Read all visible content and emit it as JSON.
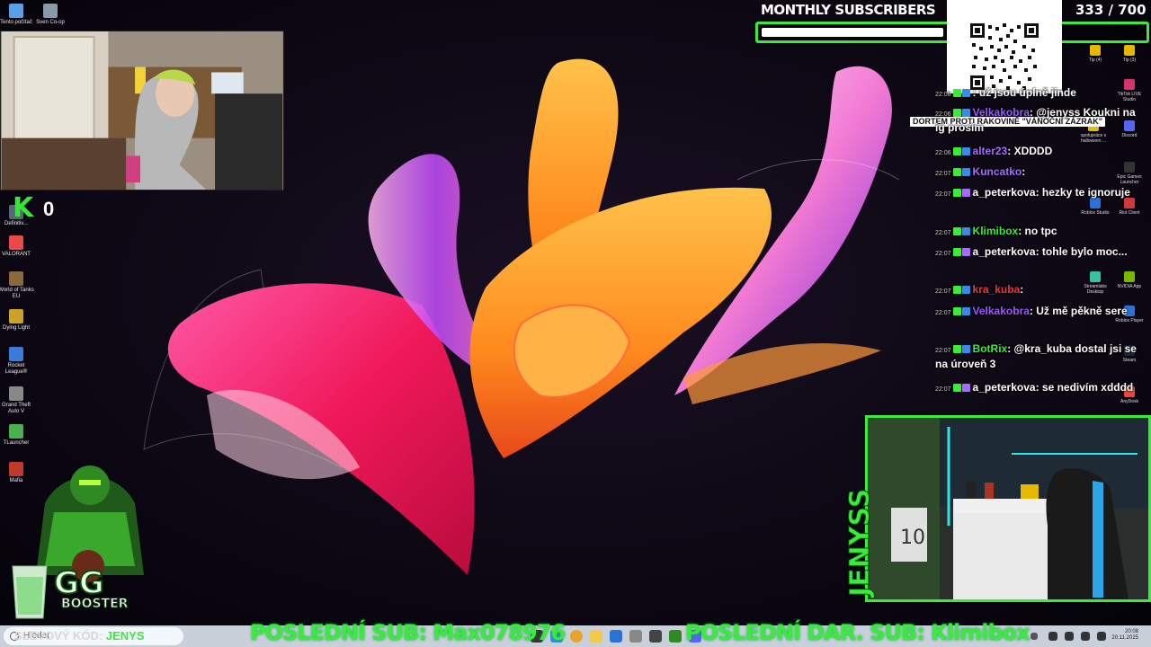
{
  "desktop_icons_left": [
    {
      "label": "Tento počítač",
      "icon": "computer-icon",
      "color": "#5aa0e6"
    },
    {
      "label": "Sven Co-op",
      "icon": "game-icon",
      "color": "#8899aa"
    },
    {
      "label": "Definitiv...",
      "icon": "game-icon",
      "color": "#556677"
    },
    {
      "label": "VALORANT",
      "icon": "valorant-icon",
      "color": "#e84a4a"
    },
    {
      "label": "World of Tanks EU",
      "icon": "tank-icon",
      "color": "#8a6a3a"
    },
    {
      "label": "Dying Light",
      "icon": "game-icon",
      "color": "#c9a227"
    },
    {
      "label": "Rocket League®",
      "icon": "rocket-icon",
      "color": "#3a7ad8"
    },
    {
      "label": "Grand Theft Auto V",
      "icon": "gta-icon",
      "color": "#888888"
    },
    {
      "label": "TLauncher",
      "icon": "minecraft-icon",
      "color": "#4caf50"
    },
    {
      "label": "Mafia",
      "icon": "mafia-icon",
      "color": "#c0392b"
    }
  ],
  "desktop_icons_right": [
    {
      "label": "Tip (4)",
      "icon": "tip-icon",
      "color": "#e6b800"
    },
    {
      "label": "Tip (3)",
      "icon": "tip-icon",
      "color": "#e6b800"
    },
    {
      "label": "TikTok LIVE Studio",
      "icon": "tiktok-icon",
      "color": "#d6336c"
    },
    {
      "label": "spolupráce s halloween ...",
      "icon": "folder-icon",
      "color": "#e6b800"
    },
    {
      "label": "Discord",
      "icon": "discord-icon",
      "color": "#5865f2"
    },
    {
      "label": "Epic Games Launcher",
      "icon": "epic-icon",
      "color": "#333333"
    },
    {
      "label": "Riot Client",
      "icon": "riot-icon",
      "color": "#d13639"
    },
    {
      "label": "Roblox Studio",
      "icon": "roblox-icon",
      "color": "#2a72d8"
    },
    {
      "label": "Streamlabs Desktop",
      "icon": "streamlabs-icon",
      "color": "#31c3a2"
    },
    {
      "label": "NVIDIA App",
      "icon": "nvidia-icon",
      "color": "#76b900"
    },
    {
      "label": "Roblox Player",
      "icon": "roblox-icon",
      "color": "#2a72d8"
    },
    {
      "label": "Steam",
      "icon": "steam-icon",
      "color": "#1b2838"
    },
    {
      "label": "AnyDesk",
      "icon": "anydesk-icon",
      "color": "#ef443b"
    }
  ],
  "k_counter": {
    "letter": "K",
    "value": "0"
  },
  "subscribers": {
    "title": "MONTHLY SUBSCRIBERS",
    "count": "333 / 700",
    "progress": 0.476
  },
  "banner": {
    "text": "DORTEM PROTI RAKOVINĚ \"VÁNOČNÍ ZÁZRAK\""
  },
  "chat": [
    {
      "time": "22:06",
      "user": "",
      "user_color": "#a66bff",
      "text": ": už jsou úplně jinde"
    },
    {
      "time": "22:06",
      "user": "Velkakobra",
      "user_color": "#9b59ff",
      "text": ": @jenyss Koukni na ig prosím"
    },
    {
      "time": "22:06",
      "user": "alter23",
      "user_color": "#a66bff",
      "text": ": XDDDD"
    },
    {
      "time": "22:07",
      "user": "Kuncatko",
      "user_color": "#a66bff",
      "text": ":"
    },
    {
      "time": "22:07",
      "user": "a_peterkova",
      "user_color": "#ffffff",
      "text": ": hezky te ignoruje"
    },
    {
      "time": "22:07",
      "user": "Klimibox",
      "user_color": "#3bea3b",
      "text": ": no tpc"
    },
    {
      "time": "22:07",
      "user": "a_peterkova",
      "user_color": "#ffffff",
      "text": ": tohle bylo moc..."
    },
    {
      "time": "22:07",
      "user": "kra_kuba",
      "user_color": "#e03a3a",
      "text": ":"
    },
    {
      "time": "22:07",
      "user": "Velkakobra",
      "user_color": "#9b59ff",
      "text": ": Už mě pěkně sere"
    },
    {
      "time": "22:07",
      "user": "BotRix",
      "user_color": "#3bea3b",
      "text": ": @kra_kuba dostal jsi se na úroveň 3"
    },
    {
      "time": "22:07",
      "user": "a_peterkova",
      "user_color": "#ffffff",
      "text": ": se nedivím xdddd"
    }
  ],
  "streamer_name": "JENYSS",
  "mascot": {
    "text": "BOOSTER",
    "letters": "GG"
  },
  "bottom": {
    "promo_prefix": "SLEVOVÝ KÓD:",
    "promo_code": "JENYS",
    "last_sub": "POSLEDNÍ SUB: Max078976",
    "last_gift_sub": "POSLEDNÍ DAR. SUB: Klimibox"
  },
  "taskbar": {
    "search_placeholder": "Hledat",
    "time": "20:08",
    "date": "20.11.2025"
  }
}
